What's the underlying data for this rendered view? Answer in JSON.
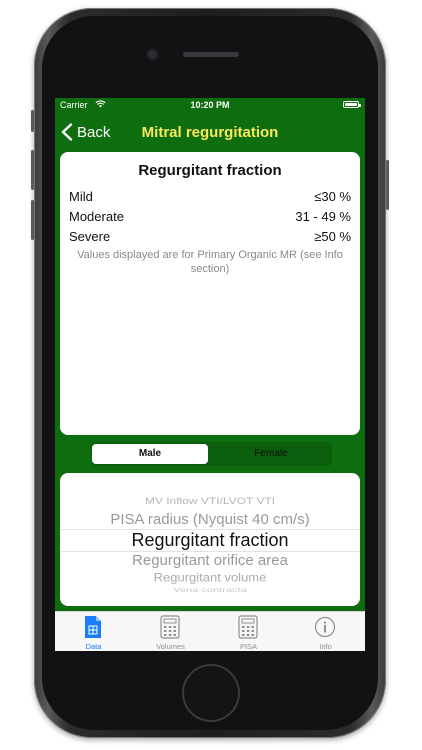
{
  "status_bar": {
    "carrier": "Carrier",
    "time": "10:20 PM"
  },
  "nav": {
    "back_label": "Back",
    "title": "Mitral regurgitation"
  },
  "card": {
    "title": "Regurgitant fraction",
    "rows": [
      {
        "label": "Mild",
        "value": "≤30 %"
      },
      {
        "label": "Moderate",
        "value": "31 - 49 %"
      },
      {
        "label": "Severe",
        "value": "≥50 %"
      }
    ],
    "note": "Values displayed are for Primary Organic MR (see Info section)"
  },
  "gender_segment": {
    "options": [
      "Male",
      "Female"
    ],
    "selected": "Male"
  },
  "picker": {
    "items": [
      "MV Inflow VTI/LVOT VTI",
      "PISA radius (Nyquist 40 cm/s)",
      "Regurgitant fraction",
      "Regurgitant orifice area",
      "Regurgitant volume",
      "Vena contracta"
    ],
    "selected": "Regurgitant fraction"
  },
  "tabs": [
    {
      "label": "Data",
      "icon": "document-icon",
      "active": true
    },
    {
      "label": "Volumes",
      "icon": "calculator-icon",
      "active": false
    },
    {
      "label": "PISA",
      "icon": "calculator-icon",
      "active": false
    },
    {
      "label": "Info",
      "icon": "info-icon",
      "active": false
    }
  ],
  "colors": {
    "accent_green": "#0e6d0e",
    "title_yellow": "#f5e85c",
    "tab_active": "#1a7cf6"
  }
}
